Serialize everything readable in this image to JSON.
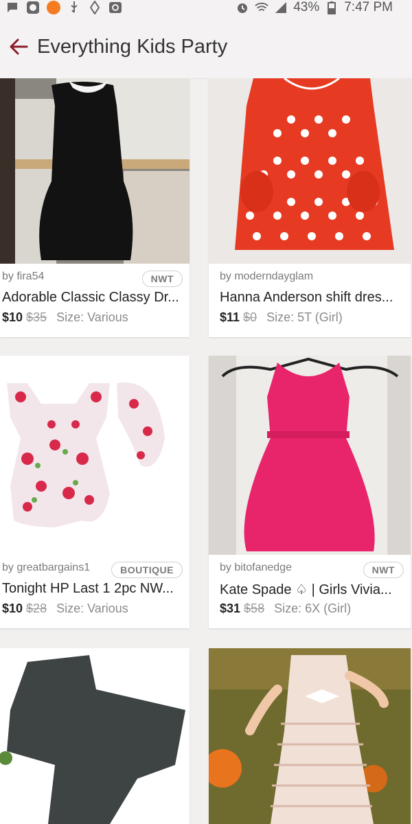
{
  "status_bar": {
    "battery": "43%",
    "time": "7:47 PM",
    "icons": [
      "chat-icon",
      "app-icon",
      "orange-notification-icon",
      "usb-icon",
      "location-icon",
      "sync-icon",
      "alarm-icon",
      "wifi-icon",
      "signal-icon",
      "battery-icon"
    ]
  },
  "header": {
    "title": "Everything Kids Party",
    "back_icon": "back-arrow-icon",
    "accent_color": "#8b1a2a"
  },
  "listings": [
    {
      "seller": "by fira54",
      "badge": "NWT",
      "title": "Adorable Classic Classy Dr...",
      "price": "$10",
      "original_price": "$35",
      "size": "Size: Various"
    },
    {
      "seller": "by moderndayglam",
      "badge": "",
      "title": "Hanna Anderson shift dres...",
      "price": "$11",
      "original_price": "$0",
      "size": "Size: 5T (Girl)"
    },
    {
      "seller": "by greatbargains1",
      "badge": "BOUTIQUE",
      "title": "Tonight HP Last 1 2pc NW...",
      "price": "$10",
      "original_price": "$28",
      "size": "Size: Various"
    },
    {
      "seller": "by bitofanedge",
      "badge": "NWT",
      "title": "Kate Spade ♤ | Girls Vivia...",
      "price": "$31",
      "original_price": "$58",
      "size": "Size: 6X (Girl)"
    },
    {
      "seller": "",
      "badge": "",
      "title": "",
      "price": "",
      "original_price": "",
      "size": ""
    },
    {
      "seller": "",
      "badge": "",
      "title": "",
      "price": "",
      "original_price": "",
      "size": ""
    }
  ]
}
